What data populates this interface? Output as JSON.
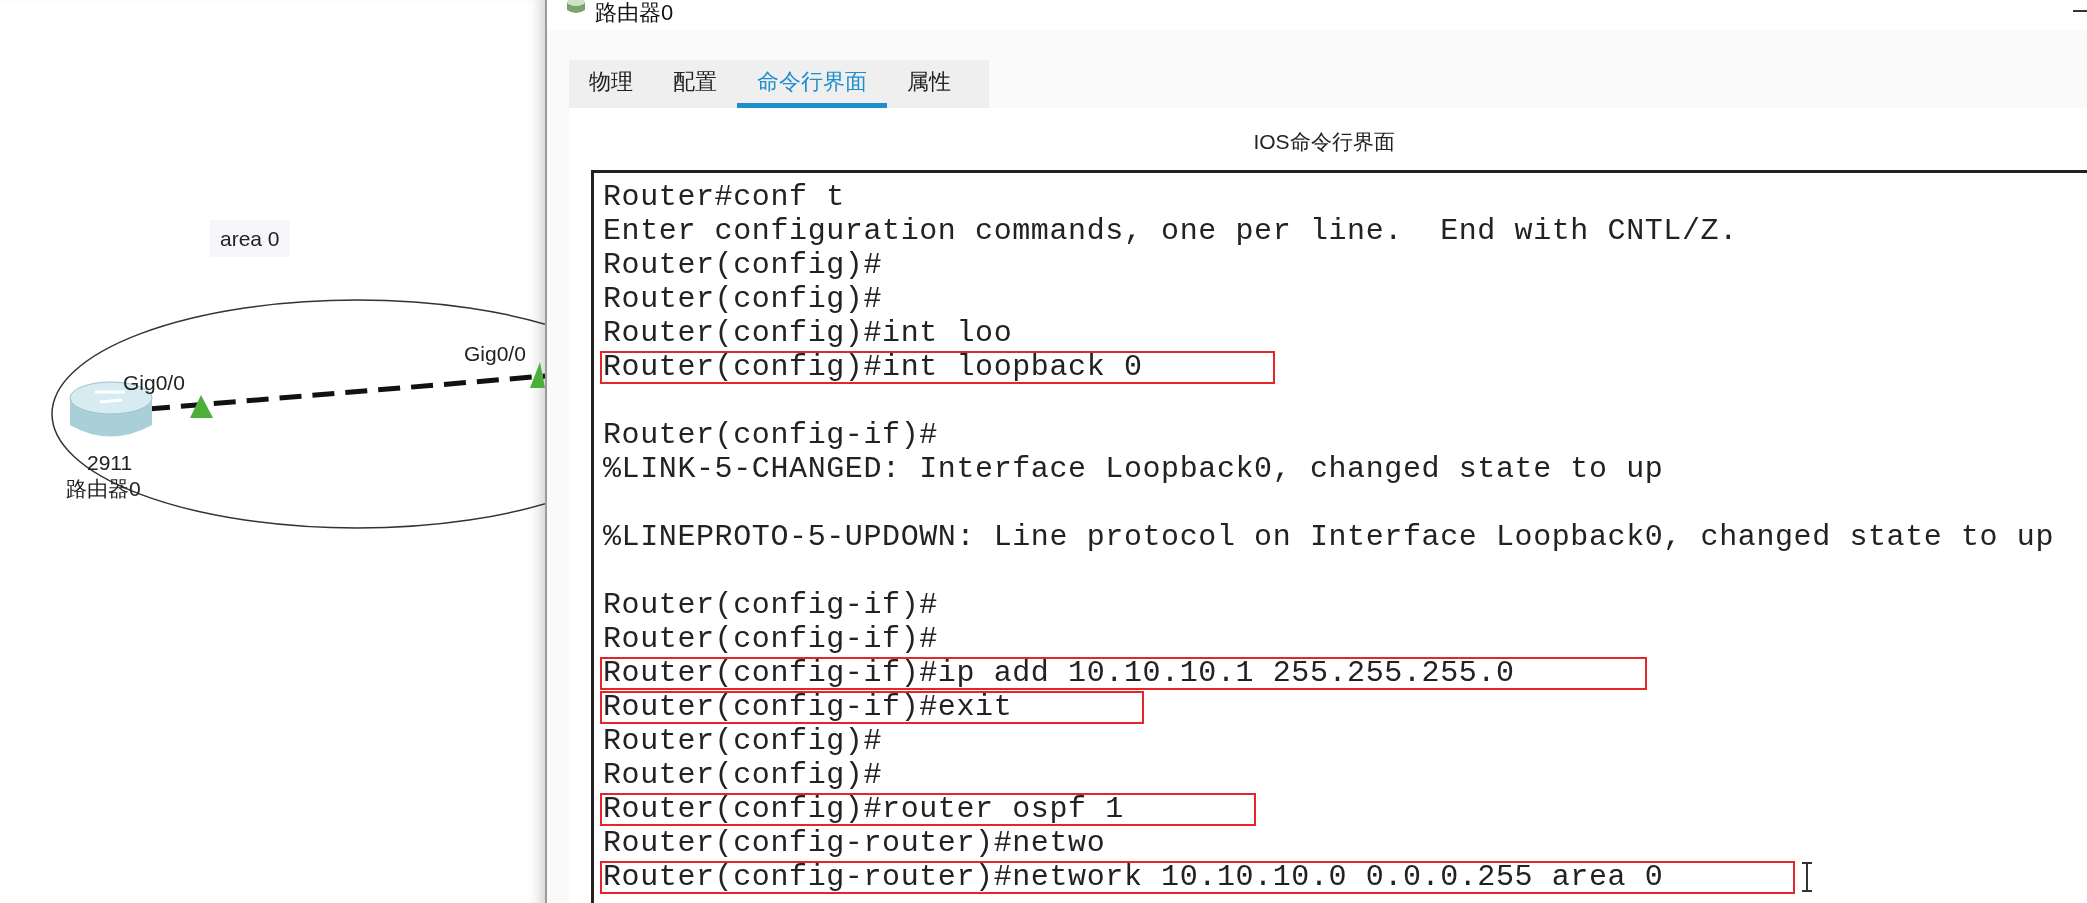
{
  "canvas": {
    "area_label": "area 0",
    "link": {
      "port_a": "Gig0/0",
      "port_b": "Gig0/0",
      "up_a": true,
      "up_b": true
    },
    "device": {
      "model": "2911",
      "name": "路由器0"
    }
  },
  "dialog": {
    "title": "路由器0",
    "tabs": [
      {
        "label": "物理",
        "selected": false
      },
      {
        "label": "配置",
        "selected": false
      },
      {
        "label": "命令行界面",
        "selected": true
      },
      {
        "label": "属性",
        "selected": false
      }
    ],
    "heading": "IOS命令行界面",
    "console": {
      "lines": [
        {
          "kind": "text",
          "text": "Router#conf t",
          "highlighted": false
        },
        {
          "kind": "text",
          "text": "Enter configuration commands, one per line.  End with CNTL/Z.",
          "highlighted": false
        },
        {
          "kind": "text",
          "text": "Router(config)#",
          "highlighted": false
        },
        {
          "kind": "text",
          "text": "Router(config)#",
          "highlighted": false
        },
        {
          "kind": "text",
          "text": "Router(config)#int loo",
          "highlighted": false
        },
        {
          "kind": "text",
          "text": "Router(config)#int loopback 0",
          "highlighted": true
        },
        {
          "kind": "blank"
        },
        {
          "kind": "text",
          "text": "Router(config-if)#",
          "highlighted": false
        },
        {
          "kind": "text",
          "text": "%LINK-5-CHANGED: Interface Loopback0, changed state to up",
          "highlighted": false
        },
        {
          "kind": "blank"
        },
        {
          "kind": "text",
          "text": "%LINEPROTO-5-UPDOWN: Line protocol on Interface Loopback0, changed state to up",
          "highlighted": false
        },
        {
          "kind": "blank"
        },
        {
          "kind": "text",
          "text": "Router(config-if)#",
          "highlighted": false
        },
        {
          "kind": "text",
          "text": "Router(config-if)#",
          "highlighted": false
        },
        {
          "kind": "text",
          "text": "Router(config-if)#ip add 10.10.10.1 255.255.255.0",
          "highlighted": true
        },
        {
          "kind": "text",
          "text": "Router(config-if)#exit",
          "highlighted": true
        },
        {
          "kind": "text",
          "text": "Router(config)#",
          "highlighted": false
        },
        {
          "kind": "text",
          "text": "Router(config)#",
          "highlighted": false
        },
        {
          "kind": "text",
          "text": "Router(config)#router ospf 1",
          "highlighted": true
        },
        {
          "kind": "text",
          "text": "Router(config-router)#netwo",
          "highlighted": false
        },
        {
          "kind": "text",
          "text": "Router(config-router)#network 10.10.10.0 0.0.0.255 area 0",
          "highlighted": true
        }
      ]
    }
  }
}
